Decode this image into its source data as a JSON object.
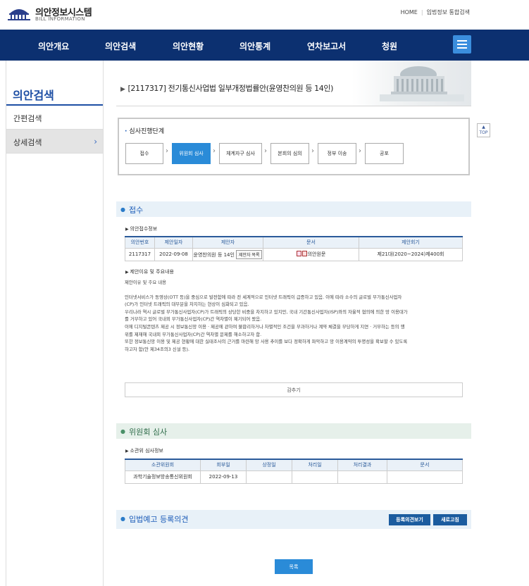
{
  "header": {
    "logo_title": "의안정보시스템",
    "logo_sub": "BILL INFORMATION",
    "top_links": [
      "HOME",
      "입법정보 통합검색"
    ]
  },
  "gnb": {
    "items": [
      "의안개요",
      "의안검색",
      "의안현황",
      "의안통계",
      "연차보고서",
      "청원"
    ]
  },
  "lnb": {
    "title": "의안검색",
    "items": [
      "간편검색",
      "상세검색"
    ],
    "active_item": "상세검색"
  },
  "bill": {
    "title": "[2117317] 전기통신사업법 일부개정법률안(윤영찬의원 등 14인)"
  },
  "process": {
    "title": "심사진행단계",
    "steps": [
      "접수",
      "위원회 심사",
      "체계자구 심사",
      "본회의 심의",
      "정부 이송",
      "공포"
    ],
    "active_step": "위원회 심사"
  },
  "top_button": {
    "label": "TOP"
  },
  "receipt": {
    "title": "접수",
    "info_label": "의안접수정보",
    "columns": [
      "의안번호",
      "제안일자",
      "제안자",
      "문서",
      "제안회기"
    ],
    "row": {
      "bill_no": "2117317",
      "date": "2022-09-08",
      "proposer": "윤영찬의원 등 14인",
      "proposer_button": "제안자 목록",
      "document": "의안원문",
      "session": "제21대(2020~2024)제400회"
    },
    "reason_label": "제안이유 및 주요내용",
    "reason_heading": "제안이유 및 주요 내용",
    "reason_lines": [
      "인터넷서비스가 동영상(OTT 등)을 중심으로 발전함에 따라 전 세계적으로 인터넷 트래픽이 급증하고 있음. 이에 따라 소수의 글로벌 부가통신사업자",
      "(CP)가 인터넷 트래픽의 대부분을 차지하는 현상이 심화되고 있음.",
      "우리나라 역시 글로벌 부가통신사업자(CP)가 트래픽의 상당한 비중을 차지하고 있지만, 국내 기간통신사업자(ISP)와의 자율적 협의에 의한 망 이용대가",
      "를 거부하고 있어 국내외 부가통신사업자(CP)간 역차별이 제기되어 왔음.",
      "이에 디지털콘텐츠 제공 시 정보통신망 이용 · 제공에 관하여 불합리하거나 차별적인 조건을 부과하거나 계약 체결을 부당하게 지연 · 거부하는 등의 행",
      "위를 제재해 국내외 부가통신사업자(CP)간 역차별 문제를 해소하고자 함.",
      "또한 정보통신망 이용 및 제공 현황에 대한 실태조사의 근거를 마련해 망 사용 추이를 보다 정확하게 파악하고 망 이용계약의 투명성을 확보할 수 있도록",
      "하고자 함(안 제34조의3 신설 등)."
    ],
    "fold_button": "감추기"
  },
  "committee": {
    "title": "위원회 심사",
    "info_label": "소관위 심사정보",
    "columns": [
      "소관위원회",
      "회부일",
      "상정일",
      "처리일",
      "처리결과",
      "문서"
    ],
    "row": {
      "committee": "과학기술정보방송통신위원회",
      "referral_date": "2022-09-13",
      "presented_date": "",
      "processed_date": "",
      "result": "",
      "document": ""
    }
  },
  "legislative_notice": {
    "title": "입법예고 등록의견",
    "view_button": "등록의견보기",
    "refresh_button": "새로고침"
  },
  "list_button": "목록"
}
